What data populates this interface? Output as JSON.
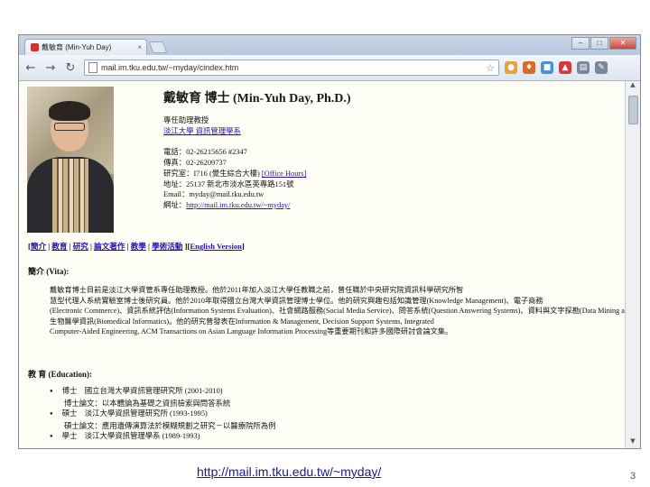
{
  "browser": {
    "tab_title": "戴敏育 (Min-Yuh Day)",
    "tab_close": "×",
    "url": "mail.im.tku.edu.tw/~myday/cindex.htm",
    "window_controls": [
      "–",
      "□",
      "✕"
    ]
  },
  "profile": {
    "name": "戴敏育 博士 (Min-Yuh Day, Ph.D.)",
    "title_line": "專任助理教授",
    "dept_link": "淡江大學 資訊管理學系",
    "contact": [
      {
        "label": "電話：",
        "value": "02-26215656 #2347",
        "link": ""
      },
      {
        "label": "傳真：",
        "value": "02-26209737",
        "link": ""
      },
      {
        "label": "研究室：",
        "value": "I716 (覺生綜合大樓) ",
        "link": "[Office Hours]"
      },
      {
        "label": "地址：",
        "value": "25137 新北市淡水區英專路151號",
        "link": ""
      },
      {
        "label": "Email：",
        "value": "myday@mail.tku.edu.tw",
        "link": ""
      },
      {
        "label": "網址：",
        "value": "",
        "link": "http://mail.im.tku.edu.tw/~myday/"
      }
    ]
  },
  "nav": {
    "open": "[",
    "items": [
      "簡介",
      "教育",
      "研究",
      "論文著作",
      "教學",
      "學術活動"
    ],
    "sep": " | ",
    "close": " ][",
    "english": "English Version",
    "end": "]"
  },
  "intro": {
    "heading": "簡介 (Vita):",
    "lines": [
      "戴敏育博士目前是淡江大學資管系專任助理教授。他於2011年加入淡江大學任教職之前，曾任職於中央研究院資訊科學研究所智",
      "慧型代理人系統實驗室博士後研究員。他於2010年取得國立台灣大學資訊管理博士學位。他的研究興趣包括知識管理(Knowledge Management)、電子商務",
      "(Electronic Commerce)、資訊系統評估(Information Systems Evaluation)、社會網路服務(Social Media Service)、問答系統(Question Answering Systems)、資料與文字探勘(Data Mining and Text Mining)、",
      "生物醫學資訊(Biomedical Informatics)。他的研究曾發表在Information & Management, Decision Support Systems, Integrated",
      "Computer-Aided Engineering, ACM Transactions on Asian Language Information Processing等重要期刊和許多國際研討會論文集。"
    ]
  },
  "education": {
    "heading": "教 育 (Education):",
    "items": [
      {
        "bullet": true,
        "text": "博士　國立台灣大學資訊管理研究所 (2001-2010)"
      },
      {
        "bullet": false,
        "text": "博士論文：以本體論為基礎之資訊檢索與問答系統"
      },
      {
        "bullet": true,
        "text": "碩士　淡江大學資訊管理研究所 (1993-1995)"
      },
      {
        "bullet": false,
        "text": "碩士論文：應用遺傳演算法於模糊規劃之研究－以醫療院所為例"
      },
      {
        "bullet": true,
        "text": "學士　淡江大學資訊管理學系 (1989-1993)"
      }
    ]
  },
  "slide": {
    "caption": "http://mail.im.tku.edu.tw/~myday/",
    "page_number": "3"
  }
}
